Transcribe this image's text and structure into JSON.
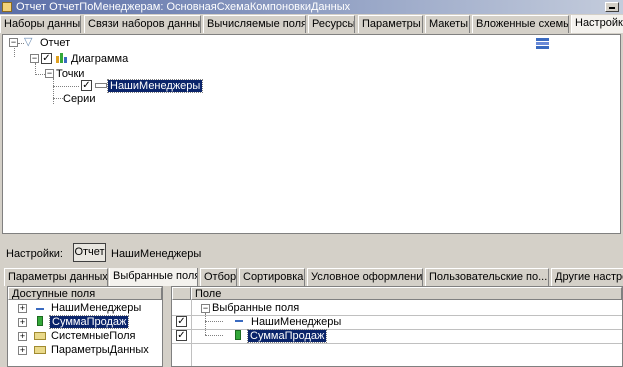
{
  "window": {
    "title": "Отчет ОтчетПоМенеджерам: ОсновнаяСхемаКомпоновкиДанных",
    "title_icon": "report-icon",
    "minimize_icon": "minimize-icon"
  },
  "top_tabs": [
    {
      "label": "Наборы данных"
    },
    {
      "label": "Связи наборов данных"
    },
    {
      "label": "Вычисляемые поля"
    },
    {
      "label": "Ресурсы"
    },
    {
      "label": "Параметры"
    },
    {
      "label": "Макеты"
    },
    {
      "label": "Вложенные схемы"
    },
    {
      "label": "Настройки"
    }
  ],
  "structure_tree": {
    "root": "Отчет",
    "chart": "Диаграмма",
    "points": "Точки",
    "selected_item": "НашиМенеджеры",
    "series": "Серии"
  },
  "settings_row": {
    "label": "Настройки:",
    "button": "Отчет",
    "value": "НашиМенеджеры"
  },
  "settings_tabs": [
    {
      "label": "Параметры данных"
    },
    {
      "label": "Выбранные поля"
    },
    {
      "label": "Отбор"
    },
    {
      "label": "Сортировка"
    },
    {
      "label": "Условное оформление"
    },
    {
      "label": "Пользовательские по..."
    },
    {
      "label": "Другие настро"
    }
  ],
  "available_fields": {
    "header": "Доступные поля",
    "items": [
      {
        "label": "НашиМенеджеры",
        "icon": "dimension-icon"
      },
      {
        "label": "СуммаПродаж",
        "icon": "resource-icon"
      },
      {
        "label": "СистемныеПоля",
        "icon": "folder-icon"
      },
      {
        "label": "ПараметрыДанных",
        "icon": "folder-icon"
      }
    ]
  },
  "selected_fields": {
    "header": "Поле",
    "group": "Выбранные поля",
    "items": [
      {
        "label": "НашиМенеджеры",
        "checked": true
      },
      {
        "label": "СуммаПродаж",
        "checked": true
      }
    ]
  }
}
